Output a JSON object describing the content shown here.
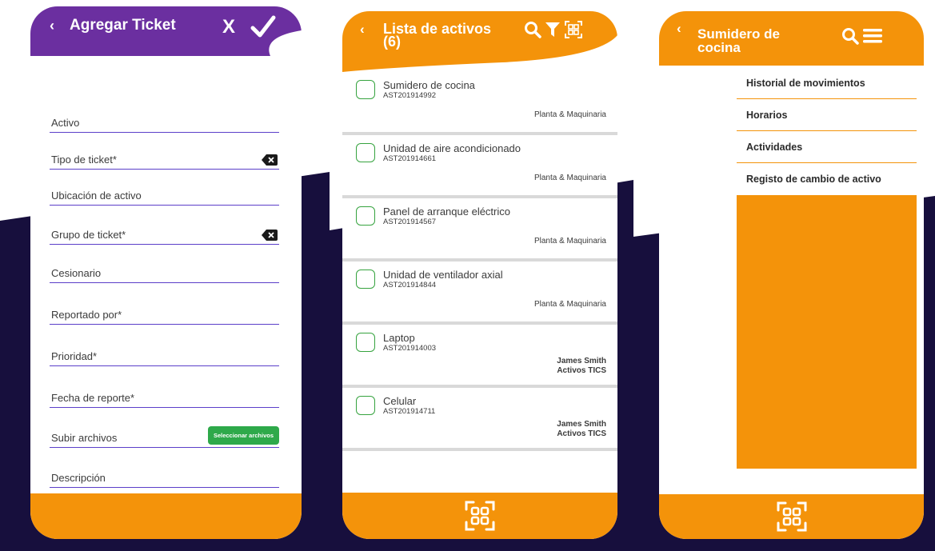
{
  "colors": {
    "purple": "#6b2fa0",
    "orange": "#f4930a",
    "navy": "#170f3d",
    "field_line": "#5b3fc9",
    "checkbox_green": "#36a33f",
    "file_button": "#2ea94a"
  },
  "screen1": {
    "title": "Agregar Ticket",
    "back_icon": "chevron-left-icon",
    "cancel_label": "X",
    "confirm_icon": "checkmark-icon",
    "fields": [
      {
        "label": "Activo",
        "has_clear": false
      },
      {
        "label": "Tipo de ticket*",
        "has_clear": true
      },
      {
        "label": "Ubicación de activo",
        "has_clear": false
      },
      {
        "label": "Grupo de ticket*",
        "has_clear": true
      },
      {
        "label": "Cesionario",
        "has_clear": false
      },
      {
        "label": "Reportado por*",
        "has_clear": false
      },
      {
        "label": "Prioridad*",
        "has_clear": false
      },
      {
        "label": "Fecha de reporte*",
        "has_clear": false
      },
      {
        "label": "Subir archivos",
        "has_clear": false
      },
      {
        "label": "Descripción",
        "has_clear": false
      }
    ],
    "file_button_label": "Seleccionar archivos"
  },
  "screen2": {
    "title_line1": "Lista de activos",
    "title_line2": "(6)",
    "header_icons": [
      "search-icon",
      "filter-icon",
      "qr-scan-icon"
    ],
    "assets": [
      {
        "name": "Sumidero de cocina",
        "code": "AST201914992",
        "category": "Planta & Maquinaria"
      },
      {
        "name": "Unidad de aire acondicionado",
        "code": "AST201914661",
        "category": "Planta & Maquinaria"
      },
      {
        "name": "Panel de arranque eléctrico",
        "code": "AST201914567",
        "category": "Planta & Maquinaria"
      },
      {
        "name": "Unidad de ventilador axial",
        "code": "AST201914844",
        "category": "Planta & Maquinaria"
      },
      {
        "name": "Laptop",
        "code": "AST201914003",
        "owner": "James Smith",
        "category": "Activos TICS"
      },
      {
        "name": "Celular",
        "code": "AST201914711",
        "owner": "James Smith",
        "category": "Activos TICS"
      }
    ],
    "footer_icon": "qr-scan-icon"
  },
  "screen3": {
    "title_line1": "Sumidero de",
    "title_line2": "cocina",
    "header_icons": [
      "search-icon",
      "hamburger-menu-icon"
    ],
    "menu_items": [
      "Historial de movimientos",
      "Horarios",
      "Actividades",
      "Registo de cambio de activo"
    ],
    "footer_icon": "qr-scan-icon"
  }
}
